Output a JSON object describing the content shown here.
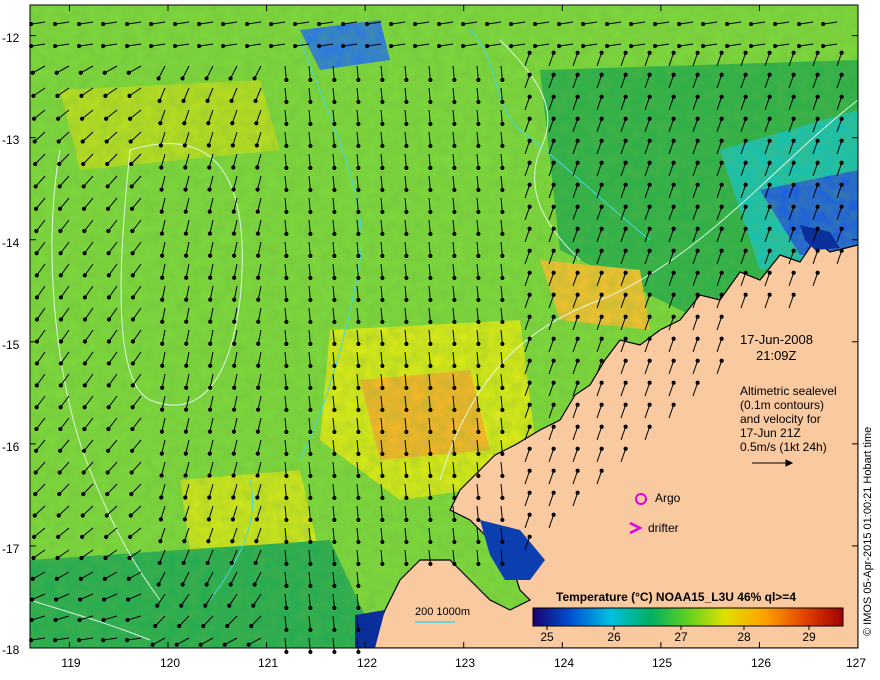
{
  "map": {
    "lat_ticks": [
      "-12",
      "-13",
      "-14",
      "-15",
      "-16",
      "-17",
      "-18"
    ],
    "lon_ticks": [
      "119",
      "120",
      "121",
      "122",
      "123",
      "124",
      "125",
      "126",
      "127"
    ],
    "lon_range": [
      118.6,
      127
    ],
    "lat_range": [
      -11.7,
      -18
    ],
    "land_color": "#f9c9a0",
    "coast_color": "#000000"
  },
  "annotations": {
    "date": "17-Jun-2008",
    "time": "21:09Z",
    "velocity_note": [
      "Altimetric sealevel",
      "(0.1m contours)",
      "and velocity for",
      "17-Jun 21Z",
      "0.5m/s (1kt 24h)"
    ],
    "argo_label": "Argo",
    "drifter_label": "drifter",
    "depth_scale": "200  1000m"
  },
  "legend": {
    "title": "Temperature (°C) NOAA15_L3U 46% ql>=4",
    "ticks": [
      "25",
      "26",
      "27",
      "28",
      "29"
    ],
    "colors": [
      "#1a0070",
      "#0050d0",
      "#00c0e0",
      "#00b060",
      "#60d020",
      "#e0e000",
      "#ffa000",
      "#e04000",
      "#a00000"
    ]
  },
  "credit": "© IMOS 05-Apr-2015 01:00:21 Hobart time",
  "markers": {
    "argo_color": "#e000e0",
    "drifter_color": "#e000e0"
  }
}
